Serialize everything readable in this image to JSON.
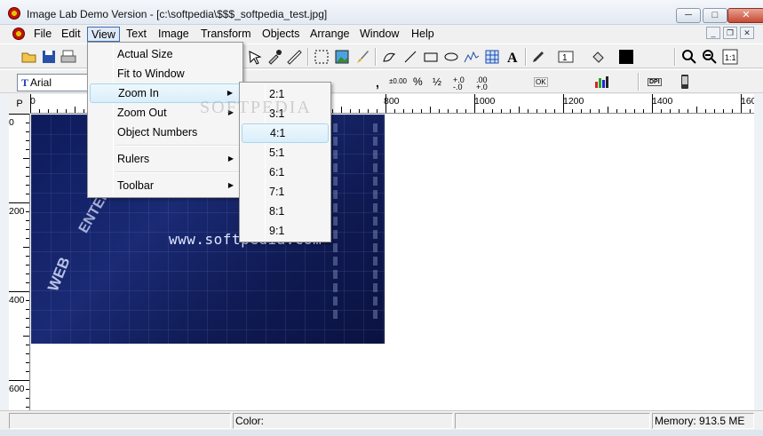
{
  "window": {
    "title": "Image Lab Demo Version - [c:\\softpedia\\$$$_softpedia_test.jpg]",
    "buttons": [
      "_",
      "▢",
      "✕"
    ]
  },
  "menubar": {
    "items": [
      "File",
      "Edit",
      "View",
      "Text",
      "Image",
      "Transform",
      "Objects",
      "Arrange",
      "Window",
      "Help"
    ],
    "active": "View"
  },
  "toolbar2": {
    "font_name": "Arial",
    "format_labels": [
      ",",
      "±0.00",
      "%",
      "½",
      "+.0",
      "-.0",
      ".00",
      "+.0",
      "OK",
      "DPI"
    ]
  },
  "view_menu": {
    "items": [
      {
        "label": "Actual Size",
        "submenu": false
      },
      {
        "label": "Fit to Window",
        "submenu": false
      },
      {
        "label": "Zoom In",
        "submenu": true,
        "highlighted": true
      },
      {
        "label": "Zoom Out",
        "submenu": true
      },
      {
        "label": "Object Numbers",
        "submenu": false
      },
      {
        "label": "Rulers",
        "submenu": true
      },
      {
        "label": "Toolbar",
        "submenu": true
      }
    ]
  },
  "zoom_in_menu": {
    "items": [
      "2:1",
      "3:1",
      "4:1",
      "5:1",
      "6:1",
      "7:1",
      "8:1",
      "9:1"
    ],
    "highlighted": "4:1"
  },
  "ruler": {
    "corner": "P",
    "h_labels": [
      "0",
      "800",
      "1000",
      "1200",
      "1400",
      "160"
    ],
    "v_labels": [
      "0",
      "200",
      "400",
      "600"
    ]
  },
  "image": {
    "site_text": "www.softpedia.com",
    "word1": "WEB",
    "word2": "ENTER"
  },
  "watermark": "SOFTPEDIA",
  "statusbar": {
    "color_label": "Color:",
    "memory": "Memory: 913.5 ME"
  }
}
